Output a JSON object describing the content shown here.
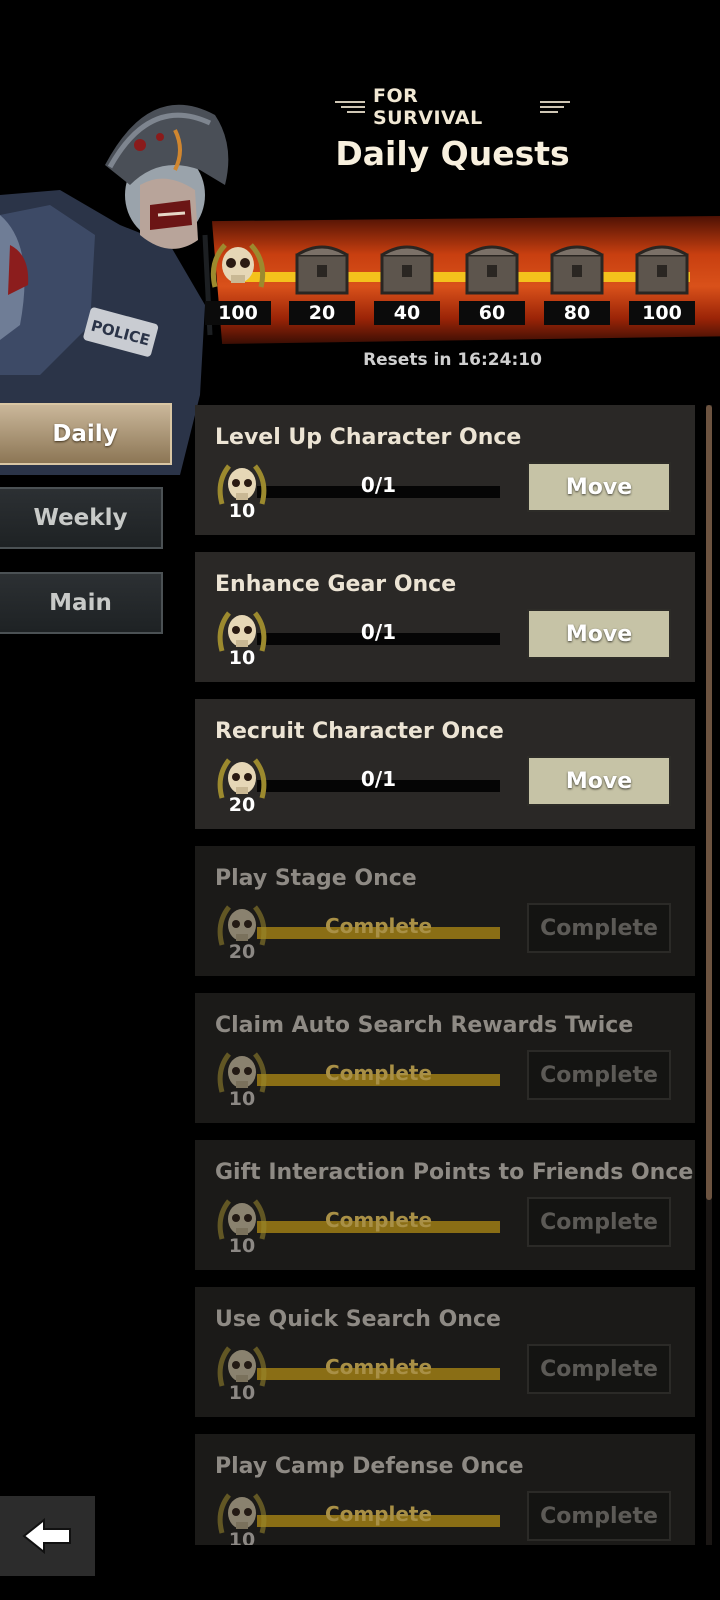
{
  "header": {
    "subtitle": "FOR SURVIVAL",
    "title": "Daily Quests"
  },
  "rewards": {
    "milestones": [
      {
        "value": "100",
        "icon": "skull-medal-icon"
      },
      {
        "value": "20",
        "icon": "chest-icon"
      },
      {
        "value": "40",
        "icon": "chest-icon"
      },
      {
        "value": "60",
        "icon": "chest-icon"
      },
      {
        "value": "80",
        "icon": "chest-icon"
      },
      {
        "value": "100",
        "icon": "chest-icon"
      }
    ],
    "reset_text": "Resets in 16:24:10"
  },
  "tabs": [
    {
      "label": "Daily",
      "active": true
    },
    {
      "label": "Weekly",
      "active": false
    },
    {
      "label": "Main",
      "active": false
    }
  ],
  "quests": [
    {
      "title": "Level Up Character Once",
      "reward": "10",
      "progress": "0/1",
      "fraction": 0,
      "button": "Move",
      "done": false
    },
    {
      "title": "Enhance Gear Once",
      "reward": "10",
      "progress": "0/1",
      "fraction": 0,
      "button": "Move",
      "done": false
    },
    {
      "title": "Recruit Character Once",
      "reward": "20",
      "progress": "0/1",
      "fraction": 0,
      "button": "Move",
      "done": false
    },
    {
      "title": "Play Stage Once",
      "reward": "20",
      "progress": "Complete",
      "fraction": 1,
      "button": "Complete",
      "done": true
    },
    {
      "title": "Claim Auto Search Rewards Twice",
      "reward": "10",
      "progress": "Complete",
      "fraction": 1,
      "button": "Complete",
      "done": true
    },
    {
      "title": "Gift Interaction Points to Friends Once",
      "reward": "10",
      "progress": "Complete",
      "fraction": 1,
      "button": "Complete",
      "done": true
    },
    {
      "title": "Use Quick Search Once",
      "reward": "10",
      "progress": "Complete",
      "fraction": 1,
      "button": "Complete",
      "done": true
    },
    {
      "title": "Play Camp Defense Once",
      "reward": "10",
      "progress": "Complete",
      "fraction": 1,
      "button": "Complete",
      "done": true
    }
  ],
  "colors": {
    "accent": "#f4c21c",
    "band": "#d9511a",
    "move_button": "#c6c3a6"
  }
}
